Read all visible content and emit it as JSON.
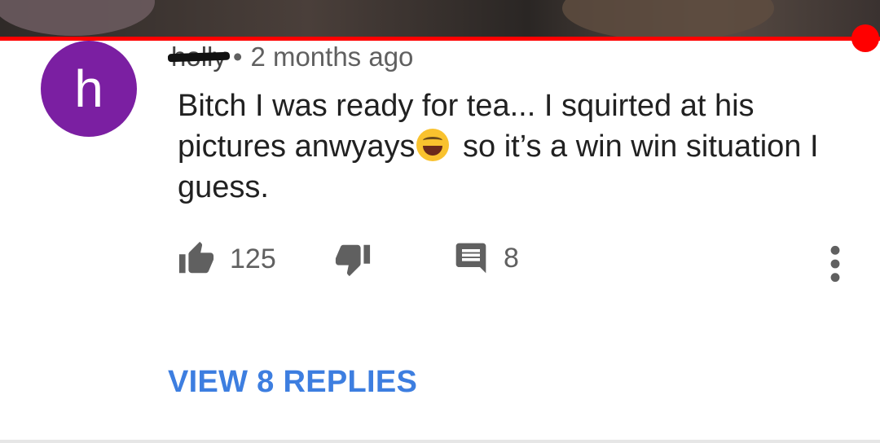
{
  "video": {
    "progress_fraction": 0.97,
    "accent": "#ff0000"
  },
  "comment": {
    "avatar_letter": "h",
    "avatar_color": "#7b1fa2",
    "author": "holly",
    "separator": "•",
    "time": "2 months ago",
    "text_before_emoji": "Bitch I was ready for tea... I squirted at his pictures anwyays",
    "emoji_icon": "face-with-tears-of-joy",
    "text_after_emoji": " so it’s a win win situation I guess.",
    "likes": "125",
    "reply_count": "8"
  },
  "view_replies_label": "VIEW 8 REPLIES",
  "colors": {
    "link": "#3d7ee0",
    "icon": "#606060"
  }
}
